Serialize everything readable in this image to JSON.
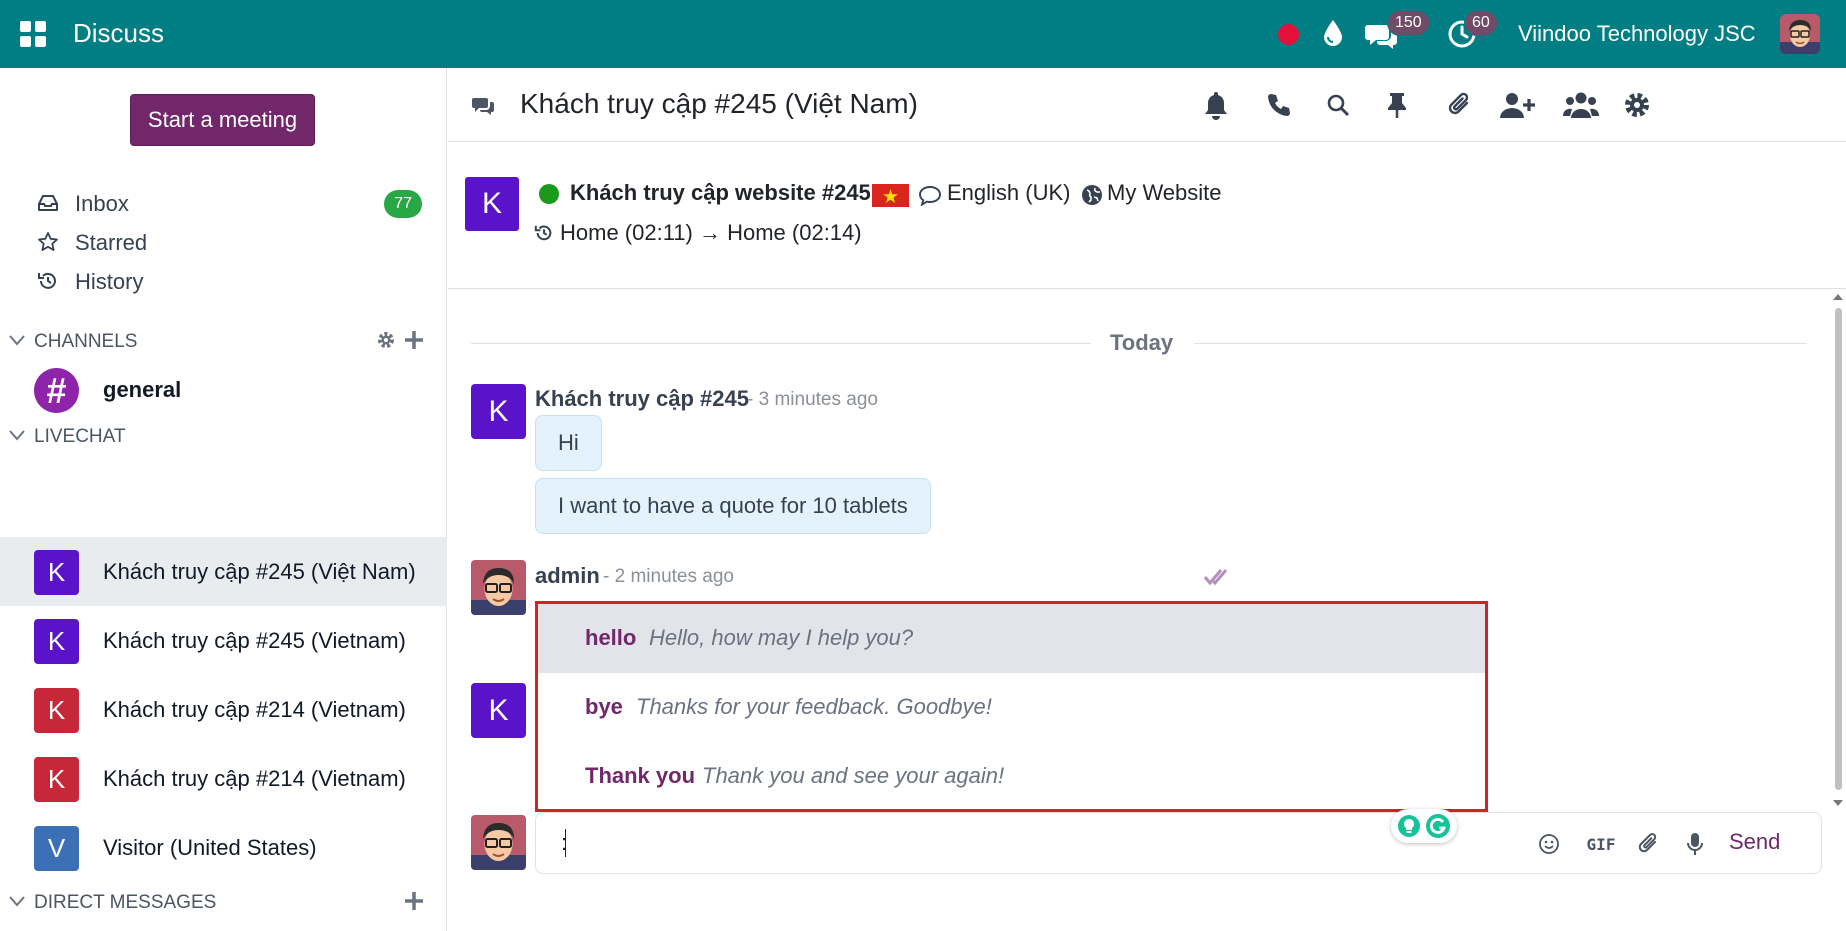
{
  "navbar": {
    "app_title": "Discuss",
    "chat_badge": "150",
    "activity_badge": "60",
    "company": "Viindoo Technology JSC"
  },
  "sidebar": {
    "start_meeting": "Start a meeting",
    "mailboxes": [
      {
        "label": "Inbox",
        "count": "77",
        "icon": "inbox-icon"
      },
      {
        "label": "Starred",
        "icon": "star-icon"
      },
      {
        "label": "History",
        "icon": "history-icon"
      }
    ],
    "categories": {
      "channels": "CHANNELS",
      "livechat": "LIVECHAT",
      "direct_messages": "DIRECT MESSAGES"
    },
    "channels": [
      {
        "avatar": "#",
        "name": "general"
      }
    ],
    "livechats": [
      {
        "avatar": "K",
        "name": "Khách truy cập #245 (Việt Nam)",
        "color": "#5b13c9",
        "active": true
      },
      {
        "avatar": "K",
        "name": "Khách truy cập #245 (Vietnam)",
        "color": "#5b13c9"
      },
      {
        "avatar": "K",
        "name": "Khách truy cập #214 (Vietnam)",
        "color": "#c62839"
      },
      {
        "avatar": "K",
        "name": "Khách truy cập #214 (Vietnam)",
        "color": "#c62839"
      },
      {
        "avatar": "V",
        "name": "Visitor (United States)",
        "color": "#3b6fb6"
      }
    ]
  },
  "thread_header": {
    "title": "Khách truy cập #245 (Việt Nam)",
    "toolbar": [
      "bell-icon",
      "phone-icon",
      "search-icon",
      "pin-icon",
      "paperclip-icon",
      "add-user-icon",
      "members-icon",
      "settings-icon"
    ]
  },
  "visitor": {
    "avatar": "K",
    "name": "Khách truy cập website #245",
    "language": "English (UK)",
    "website": "My Website",
    "history": "Home (02:11) → Home (02:14)"
  },
  "thread": {
    "separator": "Today",
    "messages": [
      {
        "avatar": "K",
        "author": "Khách truy cập #245",
        "date": "- 3 minutes ago",
        "bodies": [
          "Hi",
          "I want to have a quote for 10 tablets"
        ]
      },
      {
        "author": "admin",
        "date": "- 2 minutes ago"
      }
    ],
    "third_avatar": "K"
  },
  "suggestions": [
    {
      "key": "hello",
      "value": "Hello, how may I help you?",
      "active": true
    },
    {
      "key": "bye",
      "value": "Thanks for your feedback. Goodbye!"
    },
    {
      "key": "Thank you",
      "value": "Thank you and see your again!"
    }
  ],
  "composer": {
    "value": ":",
    "send_label": "Send",
    "gif_label": "GIF"
  },
  "colors": {
    "navbar": "#017e84",
    "brand": "#71276a",
    "highlight_border": "#d42027"
  }
}
